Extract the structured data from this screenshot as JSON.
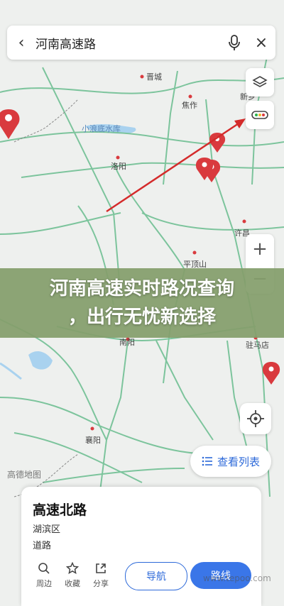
{
  "search": {
    "back_icon": "back-arrow-icon",
    "query": "河南高速路",
    "mic_icon": "microphone-icon",
    "close_icon": "close-icon"
  },
  "map": {
    "places": [
      "晋城",
      "焦作",
      "新乡",
      "小浪底水库",
      "洛阳",
      "许昌",
      "平顶山",
      "南阳",
      "驻马店",
      "襄阳"
    ],
    "brand": "高德地图",
    "colors": {
      "road": "#7cc49c",
      "land": "#eef0ee",
      "water": "#a9d2ef",
      "pin": "#d93a3e",
      "arrow": "#d42b2b"
    }
  },
  "controls": {
    "layers_icon": "layers-icon",
    "traffic_icon": "traffic-icon",
    "zoom_in": "+",
    "zoom_out": "−",
    "locate_icon": "crosshair-icon"
  },
  "banner": {
    "line1": "河南高速实时路况查询",
    "line2": "，出行无忧新选择"
  },
  "list_button": {
    "icon": "list-icon",
    "label": "查看列表"
  },
  "card": {
    "title": "高速北路",
    "district": "湖滨区",
    "type": "道路",
    "actions": [
      {
        "icon": "search-icon",
        "label": "周边"
      },
      {
        "icon": "star-icon",
        "label": "收藏"
      },
      {
        "icon": "share-icon",
        "label": "分享"
      }
    ],
    "navigate": "导航",
    "route": "路线"
  },
  "watermark": "www.tepoo.com"
}
